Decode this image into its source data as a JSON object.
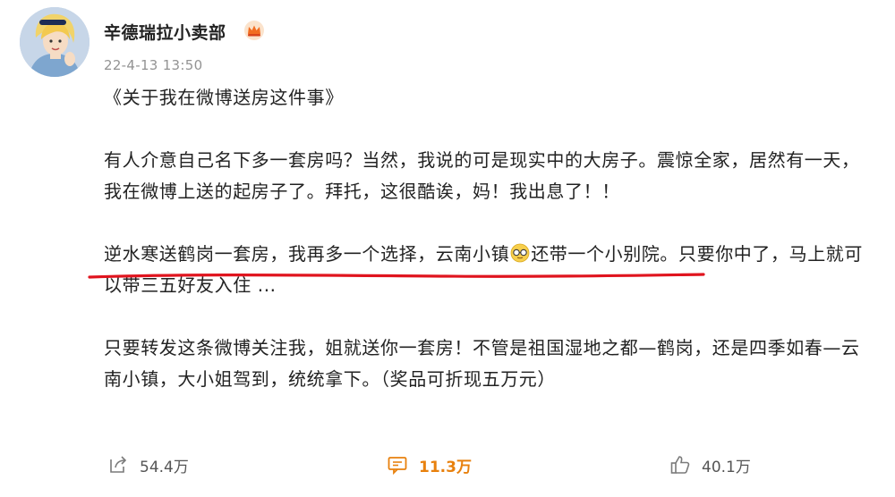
{
  "post": {
    "author": "辛德瑞拉小卖部",
    "timestamp": "22-4-13 13:50",
    "title_line": "《关于我在微博送房这件事》",
    "para1": "有人介意自己名下多一套房吗？当然，我说的可是现实中的大房子。震惊全家，居然有一天，我在微博上送的起房子了。拜托，这很酷诶，妈！我出息了！！",
    "para2_before_emoji": "逆水寒送鹤岗一套房，我再多一个选择，云南小镇",
    "para2_after_emoji": "还带一个小别院。只要你中了，马上就可以带三五好友入住 ...",
    "para3": "只要转发这条微博关注我，姐就送你一套房！不管是祖国湿地之都—鹤岗，还是四季如春—云南小镇，大小姐驾到，统统拿下。（奖品可折现五万元）"
  },
  "actions": {
    "repost_count": "54.4万",
    "comment_count": "11.3万",
    "like_count": "40.1万"
  },
  "colors": {
    "accent_orange": "#e8810e",
    "underline_red": "#e0141e",
    "timestamp_gray": "#939393"
  },
  "icons": {
    "vip": "crown-badge-icon",
    "emoji": "sunglasses-emoji-icon",
    "repost": "repost-icon",
    "comment": "comment-icon",
    "like": "thumbs-up-icon"
  }
}
